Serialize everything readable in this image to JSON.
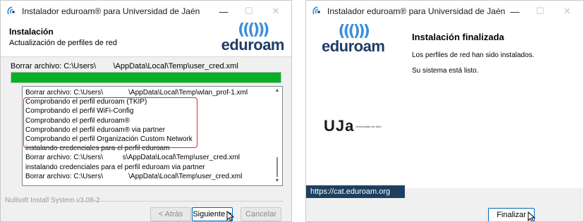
{
  "colors": {
    "accent": "#0067c0",
    "progress": "#06b025",
    "highlight": "#d62d2d",
    "url_bar": "#1f3f60",
    "logo_arcs": "#3b8fd8",
    "logo_word": "#1f3d66"
  },
  "win1": {
    "title": "Instalador eduroam® para Universidad de Jaén",
    "header": {
      "title": "Instalación",
      "subtitle": "Actualización de perfiles de red"
    },
    "logo": {
      "arcs": "((()))",
      "word": "eduroam"
    },
    "current_action": "Borrar archivo: C:\\Users\\        \\AppData\\Local\\Temp\\user_cred.xml",
    "progress_fraction": 1.0,
    "log": [
      "Borrar archivo: C:\\Users\\             \\AppData\\Local\\Temp\\wlan_prof-1.xml",
      "Comprobando el perfil eduroam (TKIP)",
      "Comprobando el perfil WiFi-Config",
      "Comprobando el perfil eduroam®",
      "Comprobando el perfil eduroam® via partner",
      "Comprobando el perfil Organización Custom Network",
      "instalando credenciales para el perfil eduroam",
      "Borrar archivo: C:\\Users\\          s\\AppData\\Local\\Temp\\user_cred.xml",
      "instalando credenciales para el perfil eduroam via partner",
      "Borrar archivo: C:\\Users\\             \\AppData\\Local\\Temp\\user_cred.xml"
    ],
    "footer_brand": "Nullsoft Install System v3.08-2",
    "buttons": {
      "back": "< Atrás",
      "next": "Siguiente >",
      "cancel": "Cancelar"
    }
  },
  "win2": {
    "title": "Instalador eduroam® para Universidad de Jaén",
    "logo": {
      "arcs": "((()))",
      "word": "eduroam"
    },
    "uja": {
      "mark": "UJa",
      "text": "Universidad de Jaén"
    },
    "url": "https://cat.eduroam.org",
    "heading": "Instalación finalizada",
    "message1": "Los perfiles de red han sido instalados.",
    "message2": "Su sistema está listo.",
    "finish_button": "Finalizar"
  }
}
